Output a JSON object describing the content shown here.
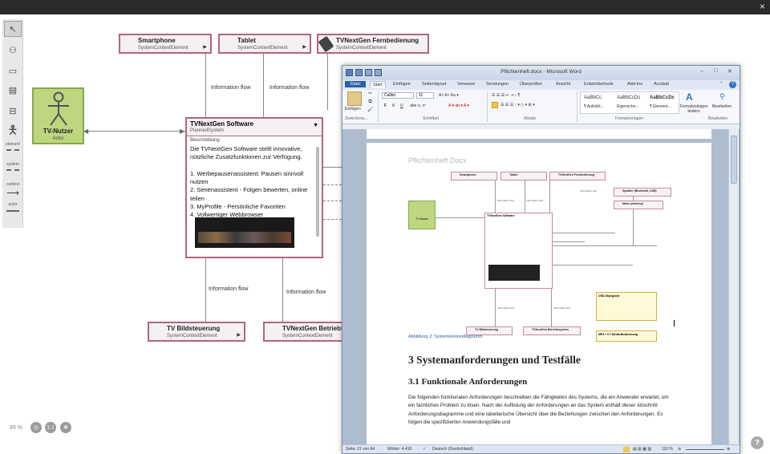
{
  "window": {
    "close_glyph": "×"
  },
  "palette": {
    "labels": [
      "element",
      "system",
      "context",
      "actor"
    ]
  },
  "actor": {
    "title": "TV-Nutzer",
    "subtitle": "Actor"
  },
  "context_elements": [
    {
      "title": "Smartphone",
      "subtitle": "SystemContextElement"
    },
    {
      "title": "Tablet",
      "subtitle": "SystemContextElement"
    },
    {
      "title": "TVNextGen Fernbedienung",
      "subtitle": "SystemContextElement"
    },
    {
      "title": "TV Bildsteuerung",
      "subtitle": "SystemContextElement"
    },
    {
      "title": "TVNextGen Betriebs",
      "subtitle": "SystemContextElement"
    }
  ],
  "flow_label": "Information flow",
  "system": {
    "title": "TVNextGen Software",
    "subtitle": "PlannedSystem",
    "desc_label": "Beschreibung",
    "description": "Die TVNextGen Software stellt innovative, nützliche Zusatzfunktionen zur Verfügung.\n\n1. Werbepausenassistent: Pausen sinnvoll nutzen\n2. Serienassistent - Folgen bewerten, online teilen\n3. MyProfile - Persönliche Favoriten\n4. Vollwertiger Webbrowser"
  },
  "zoom": {
    "value": "89",
    "unit": "%",
    "fit_label": "1:1"
  },
  "help_glyph": "?",
  "word": {
    "title": "Pflichtenheft.docx - Microsoft Word",
    "tabs": [
      "Datei",
      "Start",
      "Einfügen",
      "Seitenlayout",
      "Verweise",
      "Sendungen",
      "Überprüfen",
      "Ansicht",
      "Entwicklertools",
      "Add-Ins",
      "Acrobat"
    ],
    "ribbon": {
      "paste": "Einfügen",
      "font": "Calibri",
      "size": "11",
      "groups": [
        "Zwischena...",
        "Schriftart",
        "Absatz",
        "Formatvorlagen",
        "Bearbeiten"
      ],
      "styles": [
        {
          "sample": "AaBbCc",
          "name": "¶ Aufzähl..."
        },
        {
          "sample": "AaBbCcDc",
          "name": "Eigensche..."
        },
        {
          "sample": "AaBbCcDc",
          "name": "¶ Element..."
        }
      ],
      "change_styles": "Formatvorlagen ändern",
      "edit": "Bearbeiten"
    },
    "page": {
      "header": "Pflichtenheft.Docx",
      "figure_caption": "Abbildung 2: Systemkontextdiagramm",
      "heading1": "3     Systemanforderungen und Testfälle",
      "heading2": "3.1  Funktionale Anforderungen",
      "paragraph": "Die folgenden funktionalen Anforderungen beschreiben die Fähigkeiten des Systems, die ein Anwender erwartet, um ein fachliches Problem zu lösen. Nach der Auflistung der Anforderungen an das System enthält dieser Abschnitt Anforderungsdiagramme und eine tabellarische Übersicht über die Beziehungen zwischen den Anforderungen. Es folgen die spezifizierten Anwendungsfälle und",
      "mini": {
        "smartphone": "Smartphone",
        "tablet": "Tablet",
        "remote": "TVNextGen Fernbedienung",
        "speaker": "Speaker (Bluetooth, USB)",
        "mouse": "Maus (wireless)",
        "actor": "TV-Nutzer",
        "system": "TVNextGen Software",
        "bild": "TV Bildsteuerung",
        "betrieb": "TVNextGen Betriebssystem",
        "osd": "OSD-Styleguide",
        "codec": "MP3 + C+ Media-Bestimmung",
        "flow": "Information flow"
      }
    },
    "status": {
      "page": "Seite: 21 von 64",
      "words": "Wörter: 4.416",
      "lang": "Deutsch (Deutschland)",
      "zoom": "110 %"
    }
  },
  "colors": {
    "context_border": "#b46384",
    "actor_fill": "#bed67f",
    "word_blue": "#2d5fa8"
  }
}
